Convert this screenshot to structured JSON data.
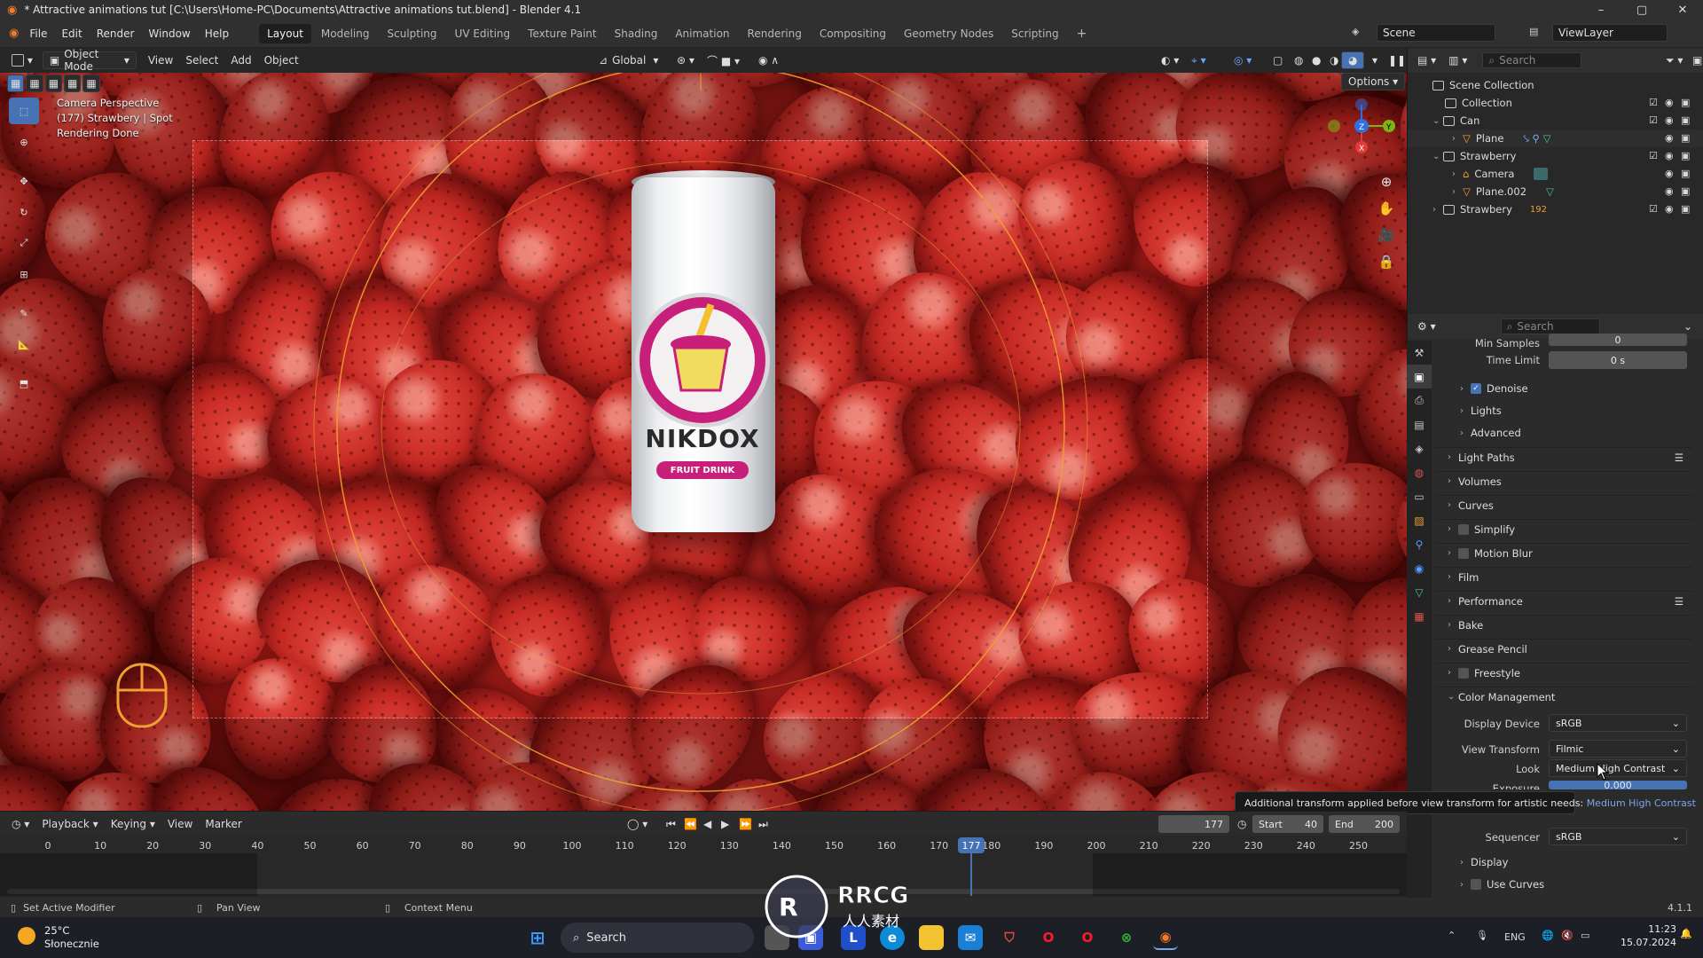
{
  "window": {
    "title": "* Attractive animations tut [C:\\Users\\Home-PC\\Documents\\Attractive animations tut.blend] - Blender 4.1"
  },
  "menu": [
    "File",
    "Edit",
    "Render",
    "Window",
    "Help"
  ],
  "workspaces": [
    "Layout",
    "Modeling",
    "Sculpting",
    "UV Editing",
    "Texture Paint",
    "Shading",
    "Animation",
    "Rendering",
    "Compositing",
    "Geometry Nodes",
    "Scripting"
  ],
  "active_workspace": "Layout",
  "scene": {
    "scene_name": "Scene",
    "view_layer": "ViewLayer"
  },
  "viewport_header": {
    "mode": "Object Mode",
    "menus": [
      "View",
      "Select",
      "Add",
      "Object"
    ],
    "orientation": "Global",
    "options": "Options"
  },
  "viewport_info": {
    "line1": "Camera Perspective",
    "line2": "(177) Strawbery | Spot",
    "line3": "Rendering Done"
  },
  "can": {
    "brand": "NIKDOX",
    "subtitle": "FRUIT DRINK"
  },
  "outliner": {
    "search_placeholder": "Search",
    "rows": [
      {
        "label": "Scene Collection"
      },
      {
        "label": "Collection"
      },
      {
        "label": "Can"
      },
      {
        "label": "Plane"
      },
      {
        "label": "Strawberry"
      },
      {
        "label": "Camera"
      },
      {
        "label": "Plane.002"
      },
      {
        "label": "Strawbery",
        "count": "192"
      }
    ]
  },
  "properties": {
    "search_placeholder": "Search",
    "min_samples_label": "Min Samples",
    "min_samples_value": "0",
    "time_limit_label": "Time Limit",
    "time_limit_value": "0 s",
    "subpanels": [
      "Denoise",
      "Lights",
      "Advanced"
    ],
    "panels": [
      "Light Paths",
      "Volumes",
      "Curves",
      "Simplify",
      "Motion Blur",
      "Film",
      "Performance",
      "Bake",
      "Grease Pencil",
      "Freestyle",
      "Color Management"
    ],
    "color_management": {
      "display_device_label": "Display Device",
      "display_device_value": "sRGB",
      "view_transform_label": "View Transform",
      "view_transform_value": "Filmic",
      "look_label": "Look",
      "look_value": "Medium High Contrast",
      "exposure_label": "Exposure",
      "exposure_value": "0.000",
      "sequencer_label": "Sequencer",
      "sequencer_value": "sRGB",
      "display_label": "Display",
      "use_curves_label": "Use Curves"
    },
    "tooltip": "Additional transform applied before view transform for artistic needs:",
    "tooltip_value": "Medium High Contrast"
  },
  "timeline": {
    "menus": [
      "Playback",
      "Keying",
      "View",
      "Marker"
    ],
    "current_frame": "177",
    "start_label": "Start",
    "start_value": "40",
    "end_label": "End",
    "end_value": "200",
    "ticks": [
      "0",
      "10",
      "20",
      "30",
      "40",
      "50",
      "60",
      "70",
      "80",
      "90",
      "100",
      "110",
      "120",
      "130",
      "140",
      "150",
      "160",
      "170",
      "180",
      "190",
      "200",
      "210",
      "220",
      "230",
      "240",
      "250"
    ]
  },
  "statusbar": {
    "left": "Set Active Modifier",
    "middle": "Pan View",
    "right": "Context Menu",
    "version": "4.1.1"
  },
  "taskbar": {
    "weather_temp": "25°C",
    "weather_desc": "Słonecznie",
    "search": "Search",
    "lang": "ENG",
    "time": "11:23",
    "date": "15.07.2024"
  },
  "watermark": {
    "brand": "RRCG",
    "sub": "人人素材"
  },
  "colors": {
    "accent": "#4772b3",
    "selection_orange": "#f0a030"
  }
}
